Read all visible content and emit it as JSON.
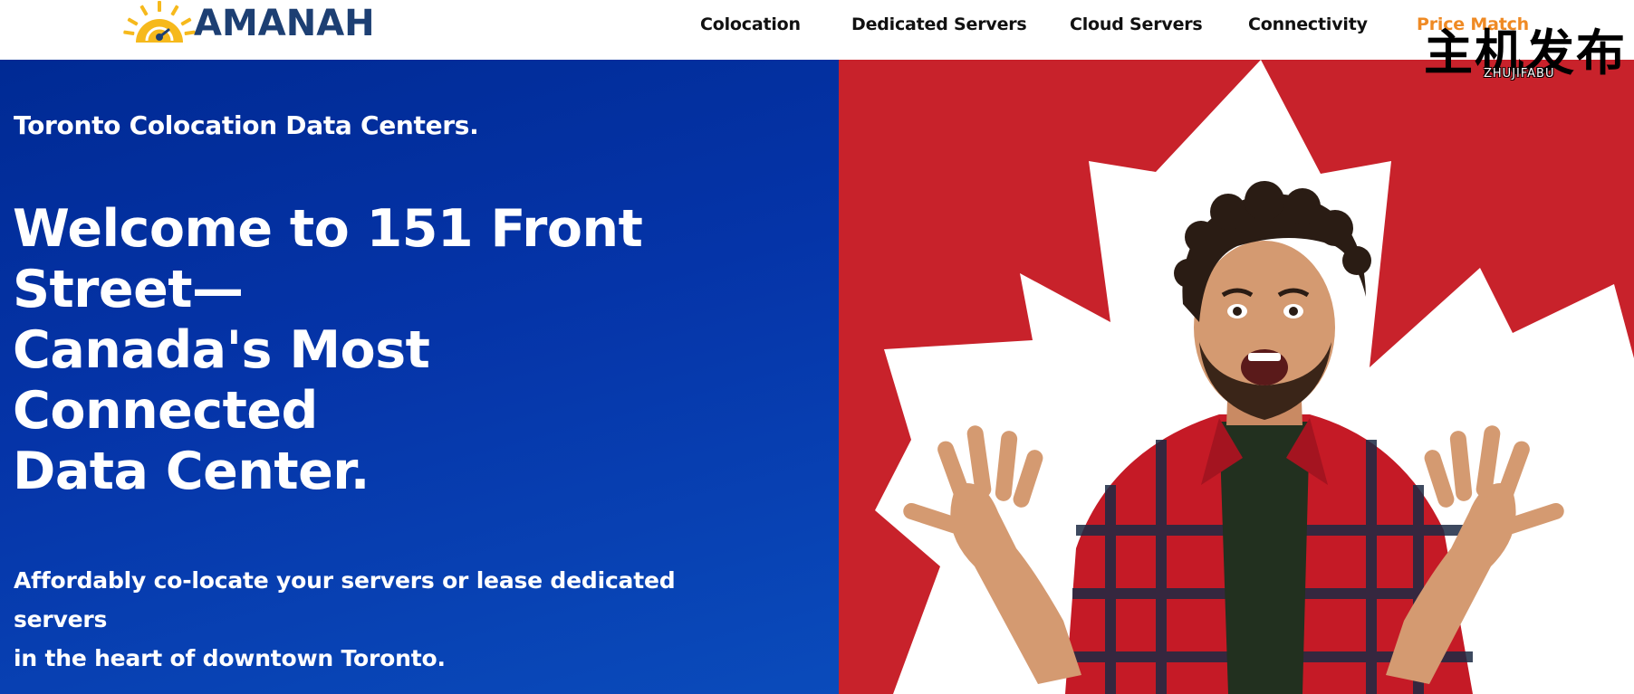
{
  "header": {
    "logo": {
      "text": "AMANAH",
      "icon": "rising-sun-logo-icon",
      "colors": {
        "text": "#1d3f73",
        "sun": "#f6b91c"
      }
    },
    "nav": [
      {
        "label": "Colocation",
        "active": false
      },
      {
        "label": "Dedicated Servers",
        "active": false
      },
      {
        "label": "Cloud Servers",
        "active": false
      },
      {
        "label": "Connectivity",
        "active": false
      },
      {
        "label": "Price Match",
        "active": true
      }
    ],
    "watermark": {
      "text": "主机发布",
      "subtext": "ZHUJIFABU"
    }
  },
  "hero": {
    "eyebrow": "Toronto Colocation Data Centers.",
    "title_lines": [
      "Welcome to 151 Front",
      "Street—",
      "Canada's Most",
      "Connected",
      "Data Center."
    ],
    "subtitle_lines": [
      "Affordably co-locate your servers or lease dedicated",
      "servers",
      "in the heart of downtown Toronto."
    ],
    "image": {
      "icon": "maple-leaf-icon",
      "subject": "excited-man-photo"
    },
    "colors": {
      "left_bg": "#0534a8",
      "right_bg": "#c8222b",
      "accent": "#ef8a24"
    }
  }
}
